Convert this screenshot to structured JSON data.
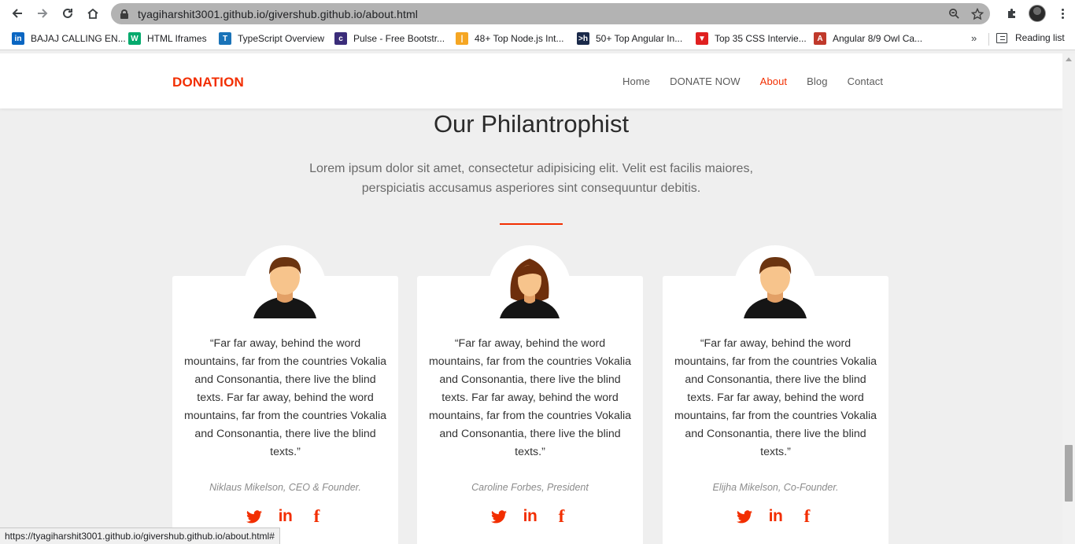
{
  "browser": {
    "url": "tyagiharshit3001.github.io/givershub.github.io/about.html",
    "bookmarks": [
      {
        "label": "BAJAJ CALLING EN...",
        "icon": "linkedin-icon",
        "color": "#0a66c2",
        "glyph": "in"
      },
      {
        "label": "HTML Iframes",
        "icon": "w3schools-icon",
        "color": "#04aa6d",
        "glyph": "W"
      },
      {
        "label": "TypeScript Overview",
        "icon": "tutorialspoint-icon",
        "color": "#1a73b8",
        "glyph": "T"
      },
      {
        "label": "Pulse - Free Bootstr...",
        "icon": "colorlib-icon",
        "color": "#3b2d7a",
        "glyph": "c"
      },
      {
        "label": "48+ Top Node.js Int...",
        "icon": "bar-chart-icon",
        "color": "#f5a623",
        "glyph": "|"
      },
      {
        "label": "50+ Top Angular In...",
        "icon": "hackr-icon",
        "color": "#1b2a4a",
        "glyph": ">h"
      },
      {
        "label": "Top 35 CSS Intervie...",
        "icon": "triangle-icon",
        "color": "#e02020",
        "glyph": "▼"
      },
      {
        "label": "Angular 8/9 Owl Ca...",
        "icon": "therichpost-icon",
        "color": "#c0392b",
        "glyph": "A"
      }
    ],
    "more_label": "»",
    "reading_list_label": "Reading list",
    "status_url": "https://tyagiharshit3001.github.io/givershub.github.io/about.html#"
  },
  "site": {
    "brand": "DONATION",
    "nav": [
      {
        "label": "Home",
        "active": false
      },
      {
        "label": "DONATE NOW",
        "active": false
      },
      {
        "label": "About",
        "active": true
      },
      {
        "label": "Blog",
        "active": false
      },
      {
        "label": "Contact",
        "active": false
      }
    ],
    "accent_color": "#f22e00"
  },
  "section": {
    "title": "Our Philantrophist",
    "lead": "Lorem ipsum dolor sit amet, consectetur adipisicing elit. Velit est facilis maiores, perspiciatis accusamus asperiores sint consequuntur debitis."
  },
  "cards": [
    {
      "avatar": "male-avatar-icon",
      "quote": "“Far far away, behind the word mountains, far from the countries Vokalia and Consonantia, there live the blind texts. Far far away, behind the word mountains, far from the countries Vokalia and Consonantia, there live the blind texts.”",
      "author": "Niklaus Mikelson, CEO & Founder."
    },
    {
      "avatar": "female-avatar-icon",
      "quote": "“Far far away, behind the word mountains, far from the countries Vokalia and Consonantia, there live the blind texts. Far far away, behind the word mountains, far from the countries Vokalia and Consonantia, there live the blind texts.”",
      "author": "Caroline Forbes, President"
    },
    {
      "avatar": "male-avatar-icon",
      "quote": "“Far far away, behind the word mountains, far from the countries Vokalia and Consonantia, there live the blind texts. Far far away, behind the word mountains, far from the countries Vokalia and Consonantia, there live the blind texts.”",
      "author": "Elijha Mikelson, Co-Founder."
    }
  ],
  "social_icons": [
    "twitter-icon",
    "linkedin-icon",
    "facebook-icon"
  ]
}
